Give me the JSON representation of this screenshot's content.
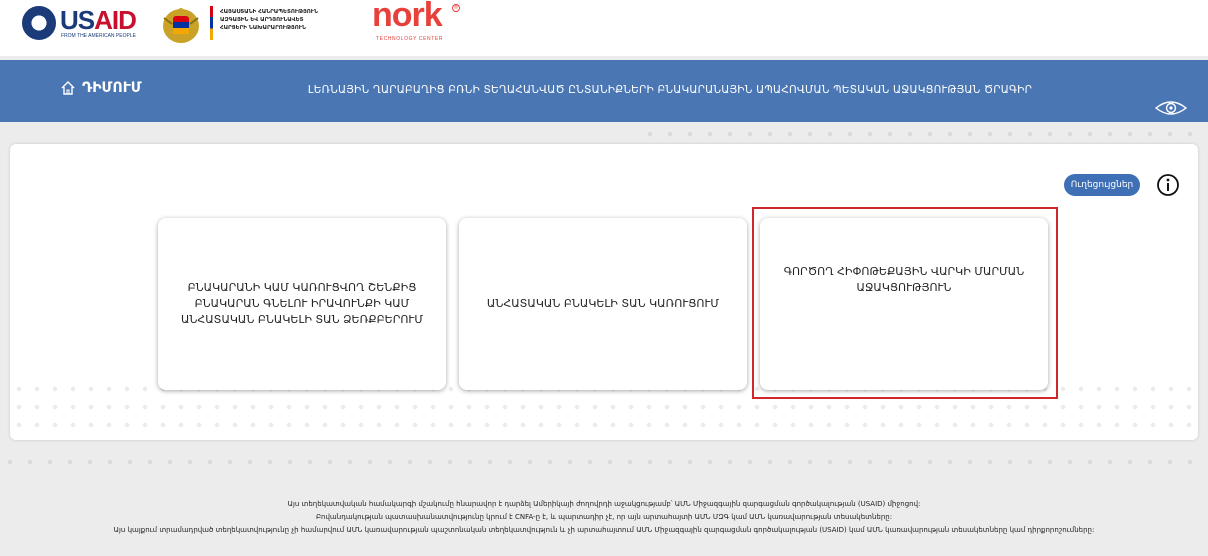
{
  "logos": {
    "usaid_us": "US",
    "usaid_aid": "AID",
    "usaid_sub": "FROM THE AMERICAN PEOPLE",
    "ministry_lines": [
      "ՀԱՅԱՍՏԱՆԻ ՀԱՆՐԱՊԵՏՈՒԹՅՈՒՆ",
      "ԱԶԳԱՅԻՆ ԵՎ ԱՐԴՅՈՒՆԱՎԵՏ",
      "ՀԱՐՑԵՐԻ ՆԱԽԱՐԱՐՈՒԹՅՈՒՆ"
    ],
    "nork_word": "nork",
    "nork_sub": "TECHNOLOGY CENTER",
    "nork_mark": "®"
  },
  "header": {
    "home_label": "ԴԻՄՈՒՄ",
    "program_title": "ԼԵՌՆԱՅԻՆ ՂԱՐԱԲԱՂԻՑ ԲՌՆԻ ՏԵՂԱՀԱՆՎԱԾ ԸՆՏԱՆԻՔՆԵՐԻ ԲՆԱԿԱՐԱՆԱՅԻՆ ԱՊԱՀՈՎՄԱՆ ՊԵՏԱԿԱՆ ԱՋԱԿՑՈՒԹՅԱՆ ԾՐԱԳԻՐ"
  },
  "card": {
    "instructions_label": "Ուղեցույցներ",
    "options": [
      {
        "label": "ԲՆԱԿԱՐԱՆԻ ԿԱՄ ԿԱՌՈՒՑՎՈՂ ՇԵՆՔԻՑ ԲՆԱԿԱՐԱՆ ԳՆԵԼՈՒ ԻՐԱՎՈՒՆՔԻ ԿԱՄ ԱՆՀԱՏԱԿԱՆ ԲՆԱԿԵԼԻ ՏԱՆ ՁԵՌՔԲԵՐՈՒՄ"
      },
      {
        "label": "ԱՆՀԱՏԱԿԱՆ ԲՆԱԿԵԼԻ ՏԱՆ ԿԱՌՈՒՑՈՒՄ"
      },
      {
        "label": "ԳՈՐԾՈՂ ՀԻՓՈԹԵՔԱՅԻՆ ՎԱՐԿԻ ՄԱՐՄԱՆ ԱՋԱԿՑՈՒԹՅՈՒՆ"
      }
    ]
  },
  "footer": {
    "lines": [
      "Այս տեղեկատվական համակարգի մշակումը հնարավոր է դարձել Ամերիկայի ժողովրդի աջակցությամբ՝ ԱՄՆ Միջազգային զարգացման գործակալության (USAID) միջոցով:",
      "Բովանդակության պատասխանատվությունը կրում է CNFA-ը է, և պարտադիր չէ, որ այն արտահայտի ԱՄՆ ՄԶԳ կամ ԱՄՆ կառավարության տեսակետները:",
      "Այս կայքում տրամադրված տեղեկատվությունը չի համարվում ԱՄՆ կառավարության պաշտոնական տեղեկատվություն և չի արտահայտում ԱՄՆ Միջազգային զարգացման գործակալության (USAID) կամ ԱՄՆ կառավարության տեսակետները կամ դիրքորոշումները:"
    ]
  },
  "colors": {
    "header_bg": "#4a77b4",
    "button_bg": "#3f6fb5",
    "highlight": "#d0262c",
    "usaid_red": "#c8102e",
    "nork_red": "#e8403b"
  }
}
